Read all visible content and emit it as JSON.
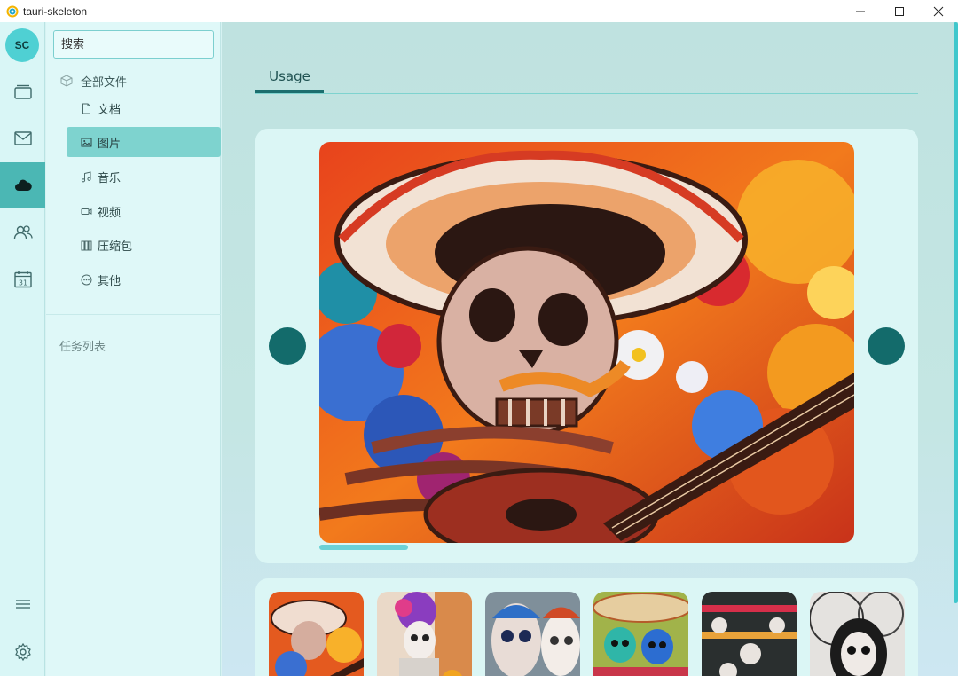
{
  "window": {
    "title": "tauri-skeleton",
    "controls": [
      "minimize-icon",
      "maximize-icon",
      "close-icon"
    ]
  },
  "rail": {
    "avatar_initials": "SC",
    "items": [
      {
        "icon": "layers-icon",
        "active": false
      },
      {
        "icon": "mail-icon",
        "active": false
      },
      {
        "icon": "cloud-icon",
        "active": true
      },
      {
        "icon": "users-icon",
        "active": false
      },
      {
        "icon": "calendar-icon",
        "active": false,
        "glyph": "31"
      }
    ],
    "bottom_items": [
      {
        "icon": "menu-icon"
      },
      {
        "icon": "gear-icon"
      }
    ]
  },
  "nav": {
    "search_placeholder": "搜索",
    "root": {
      "label": "全部文件",
      "icon": "cube-icon"
    },
    "items": [
      {
        "label": "文档",
        "icon": "file-icon",
        "active": false
      },
      {
        "label": "图片",
        "icon": "image-icon",
        "active": true
      },
      {
        "label": "音乐",
        "icon": "music-icon",
        "active": false
      },
      {
        "label": "视频",
        "icon": "video-icon",
        "active": false
      },
      {
        "label": "压缩包",
        "icon": "archive-icon",
        "active": false
      },
      {
        "label": "其他",
        "icon": "more-icon",
        "active": false
      }
    ],
    "task_list_title": "任务列表"
  },
  "main": {
    "tabs": [
      {
        "label": "Usage",
        "active": true
      }
    ],
    "carousel": {
      "current_index": 0,
      "progress": 0.166
    },
    "thumbnails_count": 6
  },
  "colors": {
    "accent": "#136b6b",
    "active_rail": "#4bb7b4",
    "active_item": "#7ed3cf",
    "progress": "#6bd1d6"
  }
}
